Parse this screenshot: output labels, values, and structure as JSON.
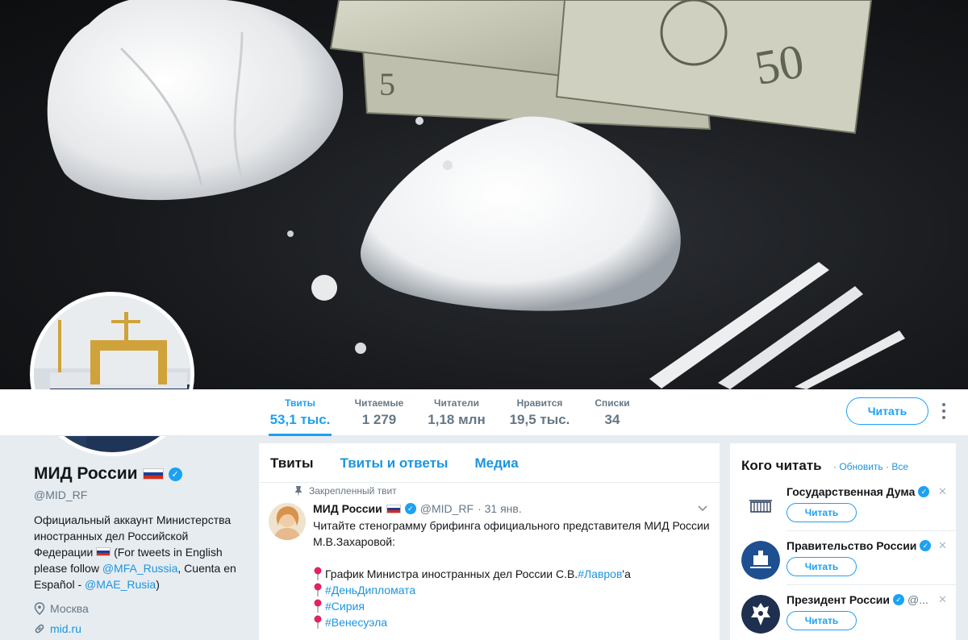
{
  "stats": [
    {
      "label": "Твиты",
      "value": "53,1 тыс.",
      "active": true
    },
    {
      "label": "Читаемые",
      "value": "1 279",
      "active": false
    },
    {
      "label": "Читатели",
      "value": "1,18 млн",
      "active": false
    },
    {
      "label": "Нравится",
      "value": "19,5 тыс.",
      "active": false
    },
    {
      "label": "Списки",
      "value": "34",
      "active": false
    }
  ],
  "follow_button": "Читать",
  "profile": {
    "name": "МИД России",
    "handle": "@MID_RF",
    "bio_part1": "Официальный аккаунт Министерства иностранных дел Российской Федерации",
    "bio_part2": "(For tweets in English please follow",
    "bio_link1": "@MFA_Russia",
    "bio_part3": ", Cuenta en Español -",
    "bio_link2": "@MAE_Rusia",
    "bio_part4": ")",
    "location": "Москва",
    "website": "mid.ru"
  },
  "timeline": {
    "tabs": [
      "Твиты",
      "Твиты и ответы",
      "Медиа"
    ],
    "pinned_label": "Закрепленный твит",
    "tweet": {
      "name": "МИД России",
      "handle": "@MID_RF",
      "date": "· 31 янв.",
      "text": "Читайте стенограмму брифинга официального представителя МИД России М.В.Захаровой:",
      "item1_text": "График Министра иностранных дел России С.В.",
      "item1_tag": "#Лавров",
      "item1_suffix": "'а",
      "hashtags": [
        "#ДеньДипломата",
        "#Сирия",
        "#Венесуэла"
      ]
    }
  },
  "who_to_follow": {
    "title": "Кого читать",
    "refresh": "Обновить",
    "all": "Все",
    "separator": "·",
    "items": [
      {
        "name": "Государственная Дума",
        "handle": "",
        "button": "Читать"
      },
      {
        "name": "Правительство России",
        "handle": "",
        "button": "Читать"
      },
      {
        "name": "Президент России",
        "handle": "@...",
        "button": "Читать"
      }
    ]
  },
  "colors": {
    "accent": "#1da1f2",
    "link": "#1b95e0",
    "muted": "#657786"
  }
}
